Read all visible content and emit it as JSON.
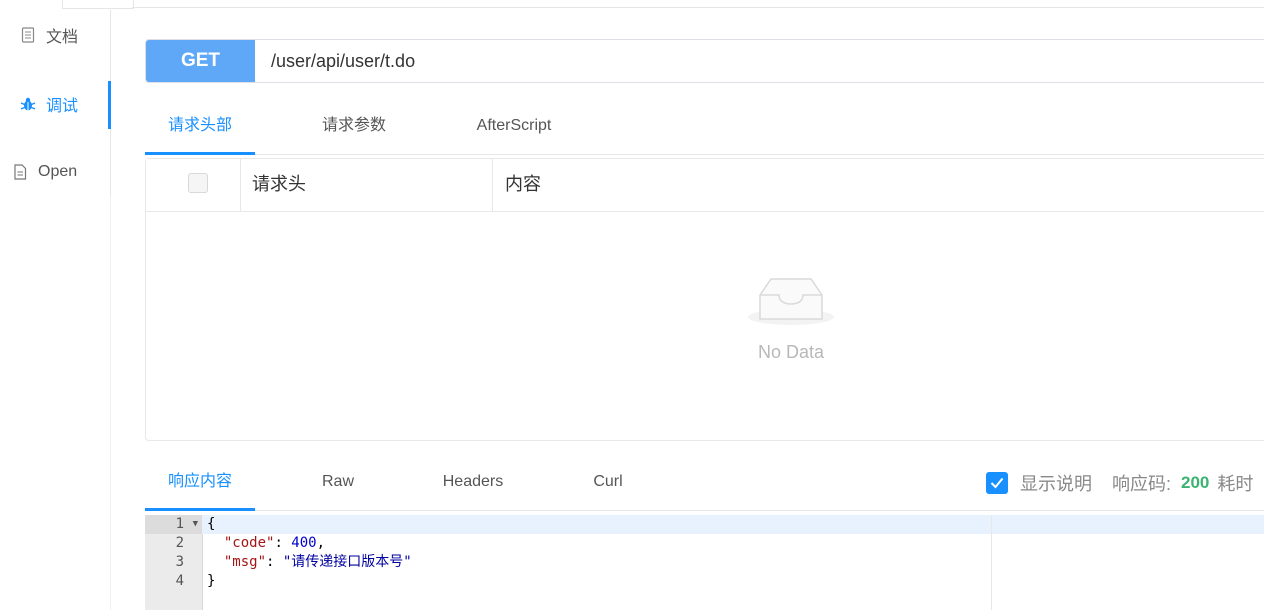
{
  "sidebar": {
    "items": [
      {
        "label": "文档",
        "icon": "document-icon"
      },
      {
        "label": "调试",
        "icon": "bug-icon"
      },
      {
        "label": "Open",
        "icon": "file-icon"
      }
    ],
    "active_index": 1
  },
  "request": {
    "method": "GET",
    "url": "/user/api/user/t.do"
  },
  "request_tabs": [
    {
      "label": "请求头部"
    },
    {
      "label": "请求参数"
    },
    {
      "label": "AfterScript"
    }
  ],
  "headers_table": {
    "columns": [
      "请求头",
      "内容"
    ],
    "empty_text": "No Data"
  },
  "response_tabs": [
    {
      "label": "响应内容"
    },
    {
      "label": "Raw"
    },
    {
      "label": "Headers"
    },
    {
      "label": "Curl"
    }
  ],
  "response_meta": {
    "show_desc_label": "显示说明",
    "show_desc_checked": true,
    "status_label": "响应码:",
    "status_code": "200",
    "time_label": "耗时"
  },
  "editor": {
    "line_numbers": [
      "1",
      "2",
      "3",
      "4"
    ],
    "lines": {
      "open": "{",
      "code_key": "\"code\"",
      "code_value": "400",
      "msg_key": "\"msg\"",
      "msg_value": "\"请传递接口版本号\"",
      "close": "}"
    }
  },
  "colors": {
    "accent": "#1890ff",
    "method_bg": "#5fa8f7",
    "status_ok": "#3cb371"
  }
}
